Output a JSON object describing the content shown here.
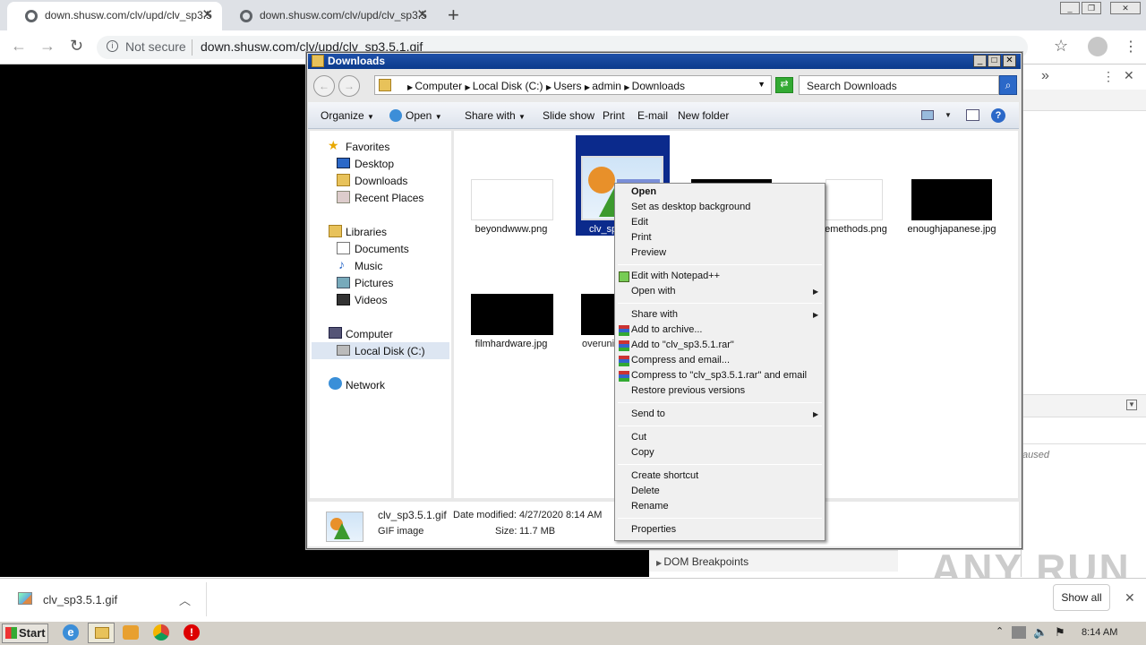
{
  "browser": {
    "tabs": [
      {
        "title": "down.shusw.com/clv/upd/clv_sp3.5"
      },
      {
        "title": "down.shusw.com/clv/upd/clv_sp3.5"
      }
    ],
    "not_secure": "Not secure",
    "url": "down.shusw.com/clv/upd/clv_sp3.5.1.gif"
  },
  "devtools": {
    "dom_breakpoints": "DOM Breakpoints",
    "paused": "aused"
  },
  "watermark": "ANY RUN",
  "download_shelf": {
    "file": "clv_sp3.5.1.gif",
    "show_all": "Show all"
  },
  "taskbar": {
    "start": "Start",
    "clock": "8:14 AM"
  },
  "explorer": {
    "title": "Downloads",
    "breadcrumb": [
      "Computer",
      "Local Disk (C:)",
      "Users",
      "admin",
      "Downloads"
    ],
    "search_placeholder": "Search Downloads",
    "commands": {
      "organize": "Organize",
      "open": "Open",
      "share_with": "Share with",
      "slide_show": "Slide show",
      "print": "Print",
      "email": "E-mail",
      "new_folder": "New folder"
    },
    "nav": {
      "favorites": "Favorites",
      "desktop": "Desktop",
      "downloads": "Downloads",
      "recent": "Recent Places",
      "libraries": "Libraries",
      "documents": "Documents",
      "music": "Music",
      "pictures": "Pictures",
      "videos": "Videos",
      "computer": "Computer",
      "local_disk": "Local Disk (C:)",
      "network": "Network"
    },
    "files": [
      {
        "name": "beyondwww.png"
      },
      {
        "name": "clv_sp"
      },
      {
        "name": "emethods.png"
      },
      {
        "name": "enoughjapanese.jpg"
      },
      {
        "name": "filmhardware.jpg"
      },
      {
        "name": "overuni"
      }
    ],
    "details": {
      "filename": "clv_sp3.5.1.gif",
      "date_label": "Date modified:",
      "date_value": "4/27/2020 8:14 AM",
      "type": "GIF image",
      "size_label": "Size:",
      "size_value": "11.7 MB"
    }
  },
  "context_menu": {
    "open": "Open",
    "set_bg": "Set as desktop background",
    "edit": "Edit",
    "print": "Print",
    "preview": "Preview",
    "edit_npp": "Edit with Notepad++",
    "open_with": "Open with",
    "share_with": "Share with",
    "add_archive": "Add to archive...",
    "add_rar": "Add to \"clv_sp3.5.1.rar\"",
    "compress_email": "Compress and email...",
    "compress_rar_email": "Compress to \"clv_sp3.5.1.rar\" and email",
    "restore": "Restore previous versions",
    "send_to": "Send to",
    "cut": "Cut",
    "copy": "Copy",
    "create_shortcut": "Create shortcut",
    "delete": "Delete",
    "rename": "Rename",
    "properties": "Properties"
  }
}
